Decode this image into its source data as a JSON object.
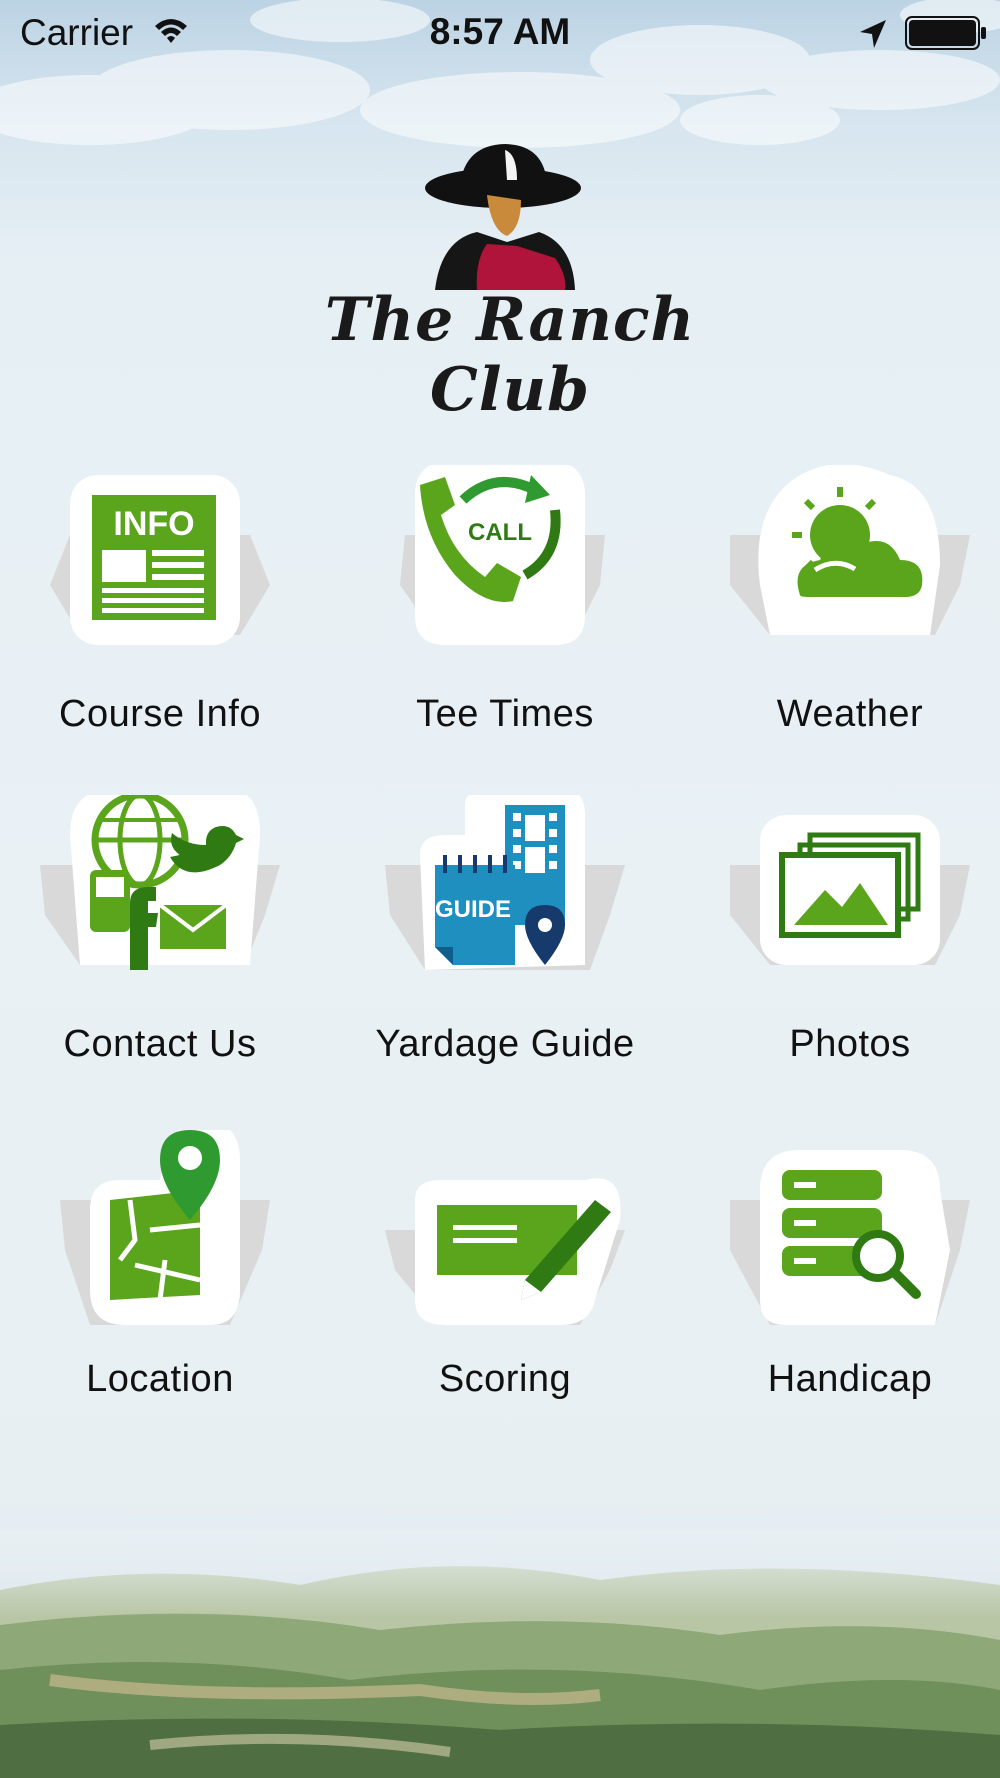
{
  "status_bar": {
    "carrier": "Carrier",
    "time": "8:57 AM",
    "icons": [
      "wifi-icon",
      "location-arrow-icon",
      "battery-icon"
    ]
  },
  "logo": {
    "text": "The Ranch Club",
    "image": "cowboy-figure-logo"
  },
  "colors": {
    "accent_green": "#5aa51c",
    "dark_green": "#2f7a12",
    "guide_blue": "#1f8fbf",
    "pin_navy": "#163a6b"
  },
  "menu": [
    {
      "label": "Course Info",
      "icon": "info-newspaper-icon",
      "icon_text": "INFO"
    },
    {
      "label": "Tee Times",
      "icon": "call-phone-icon",
      "icon_text": "CALL"
    },
    {
      "label": "Weather",
      "icon": "sun-cloud-icon"
    },
    {
      "label": "Contact Us",
      "icon": "social-contact-icon"
    },
    {
      "label": "Yardage Guide",
      "icon": "guide-book-icon",
      "icon_text": "GUIDE"
    },
    {
      "label": "Photos",
      "icon": "photo-stack-icon"
    },
    {
      "label": "Location",
      "icon": "map-pin-icon"
    },
    {
      "label": "Scoring",
      "icon": "scorecard-pencil-icon"
    },
    {
      "label": "Handicap",
      "icon": "database-search-icon"
    }
  ]
}
